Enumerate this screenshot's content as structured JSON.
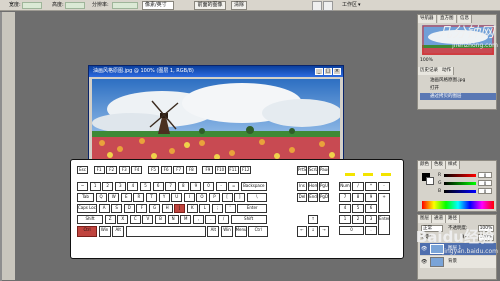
{
  "options_bar": {
    "width_label": "宽度:",
    "height_label": "高度:",
    "resolution_label": "分辨率:",
    "resolution_unit": "像素/英寸",
    "front_image_button": "前面的图像",
    "clear_button": "清除",
    "workspace_label": "工作区"
  },
  "document": {
    "title": "油画风格原图.jpg @ 100% (图层 1, RGB/8)"
  },
  "keyboard": {
    "row_fn": [
      "Esc",
      "F1",
      "F2",
      "F3",
      "F4",
      "F5",
      "F6",
      "F7",
      "F8",
      "F9",
      "F10",
      "F11",
      "F12"
    ],
    "row_num": [
      "~",
      "1",
      "2",
      "3",
      "4",
      "5",
      "6",
      "7",
      "8",
      "9",
      "0",
      "-",
      "=",
      "Backspace"
    ],
    "row_tab": [
      "Tab",
      "Q",
      "W",
      "E",
      "R",
      "T",
      "Y",
      "U",
      "I",
      "O",
      "P",
      "[",
      "]",
      "\\"
    ],
    "row_caps": [
      "Caps Lock",
      "A",
      "S",
      "D",
      "F",
      "G",
      "H",
      "J",
      "K",
      "L",
      ";",
      "'",
      "Enter"
    ],
    "row_shift": [
      "Shift",
      "Z",
      "X",
      "C",
      "V",
      "B",
      "N",
      "M",
      ",",
      ".",
      "/",
      "Shift"
    ],
    "row_ctrl": [
      "Ctrl",
      "Win",
      "Alt",
      "",
      "Alt",
      "Win",
      "Menu",
      "Ctrl"
    ],
    "nav_keys": [
      "PrtSc",
      "ScrLk",
      "Pause",
      "Ins",
      "Home",
      "PgUp",
      "Del",
      "End",
      "PgDn"
    ],
    "arrow_keys": [
      "↑",
      "←",
      "↓",
      "→"
    ],
    "numpad": [
      "Num",
      "/",
      "*",
      "-",
      "7",
      "8",
      "9",
      "+",
      "4",
      "5",
      "6",
      "1",
      "2",
      "3",
      "Enter",
      "0",
      "."
    ],
    "highlighted_keys": [
      "J",
      "Ctrl"
    ]
  },
  "navigator": {
    "tabs": [
      "导航器",
      "直方图",
      "信息"
    ],
    "zoom": "100%"
  },
  "history": {
    "tabs": [
      "历史记录",
      "动作"
    ],
    "items": [
      "油画风格原图.jpg",
      "打开",
      "通过拷贝的图层"
    ]
  },
  "color_panel": {
    "tabs": [
      "颜色",
      "色板",
      "样式"
    ],
    "channels": [
      {
        "label": "R",
        "value": "0"
      },
      {
        "label": "G",
        "value": "0"
      },
      {
        "label": "B",
        "value": "0"
      }
    ]
  },
  "layers_panel": {
    "tabs": [
      "图层",
      "通道",
      "路径"
    ],
    "blend_mode": "正常",
    "opacity_label": "不透明度:",
    "opacity": "100%",
    "lock_label": "锁定:",
    "fill_label": "填充:",
    "fill": "100%",
    "layers": [
      "图层 1",
      "背景"
    ]
  },
  "watermarks": {
    "top_text": "几分钟网",
    "top_url": "jifenzhong.com",
    "bottom_text": "Baidu经验",
    "bottom_url": "jingyan.baidu.com"
  },
  "colors": {
    "highlight_key": "#c0443e",
    "led": "#f3e400",
    "title_bar": "#0a3f9e"
  }
}
